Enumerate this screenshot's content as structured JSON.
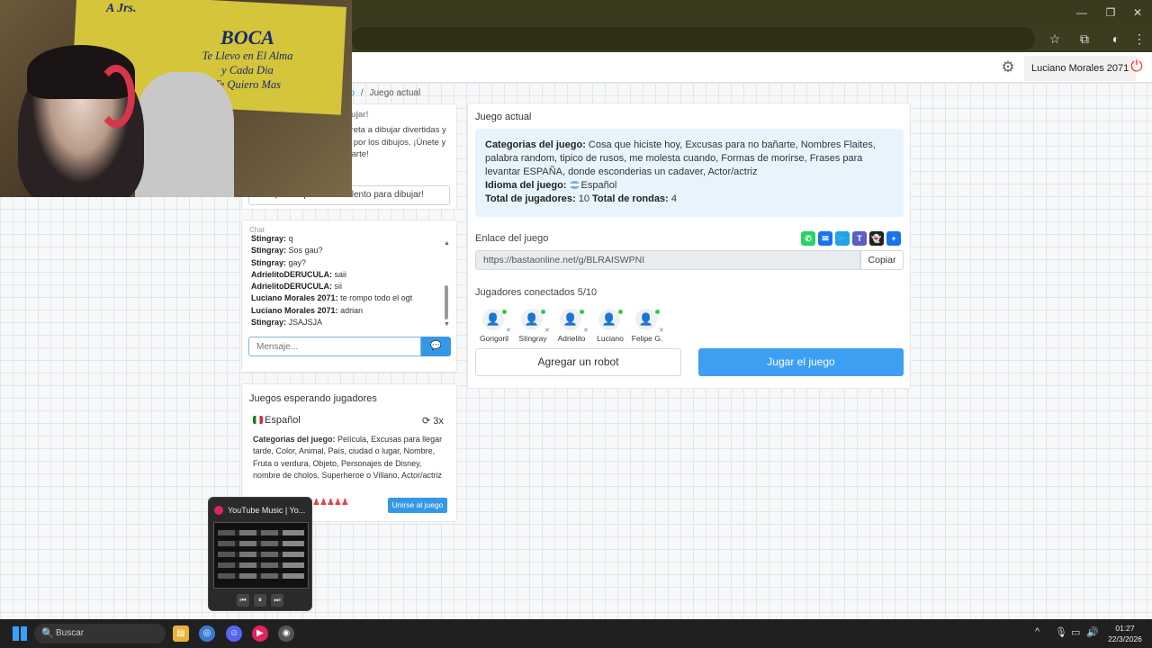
{
  "header": {
    "user_name": "Luciano Morales 2071"
  },
  "breadcrumb": {
    "prev": "evo",
    "separator": "/",
    "current": "Juego actual"
  },
  "promo": {
    "title": "a dibujar!",
    "text": "st te reta a dibujar divertidas y votar por los dibujos. ¡Únete y ra tu arte!",
    "button": "¡Pon a prueba tu talento para dibujar!"
  },
  "chat": {
    "title": "Chat",
    "messages": [
      {
        "user": "Stingray:",
        "text": "q"
      },
      {
        "user": "Stingray:",
        "text": "Sos gau?"
      },
      {
        "user": "Stingray:",
        "text": "gay?"
      },
      {
        "user": "AdrielitoDERUCULA:",
        "text": "saii"
      },
      {
        "user": "AdrielitoDERUCULA:",
        "text": "sii"
      },
      {
        "user": "Luciano Morales 2071:",
        "text": "te rompo todo el ogt"
      },
      {
        "user": "Luciano Morales 2071:",
        "text": "adrian"
      },
      {
        "user": "Stingray:",
        "text": "JSAJSJA"
      }
    ],
    "input_placeholder": "Mensaje..."
  },
  "waiting": {
    "title": "Juegos esperando jugadores",
    "language": "Español",
    "rounds": "3x",
    "categories_label": "Categorias del juego:",
    "categories": "Película, Excusas para llegar tarde, Color, Animal, País, ciudad o lugar, Nombre, Fruta o verdura, Objeto, Personajes de Disney, nombre de cholos, Superheroe o Villano, Actor/actriz",
    "join_button": "Unirse al juego"
  },
  "game": {
    "title": "Juego actual",
    "categories_label": "Categorias del juego:",
    "categories": "Cosa que hiciste hoy, Excusas para no bañarte, Nombres Flaites, palabra random, tipico de rusos, me molesta cuando, Formas de morirse, Frases para levantar ESPAÑA, donde esconderias un cadaver, Actor/actriz",
    "language_label": "Idioma del juego:",
    "language": "Español",
    "players_label": "Total de jugadores:",
    "players_total": "10",
    "rounds_label": "Total de rondas:",
    "rounds_total": "4",
    "link_label": "Enlace del juego",
    "link_value": "https://bastaonline.net/g/BLRAISWPNI",
    "copy_button": "Copiar",
    "connected_label": "Jugadores conectados 5/10",
    "players": [
      {
        "name": "Gorigoril"
      },
      {
        "name": "Stingray"
      },
      {
        "name": "Adrielito"
      },
      {
        "name": "Luciano"
      },
      {
        "name": "Felipe G."
      }
    ],
    "robot_button": "Agregar un robot",
    "play_button": "Jugar el juego"
  },
  "webcam": {
    "banner_left": "A Jrs.",
    "banner_title": "BOCA",
    "banner_lines": [
      "Te Llevo en El Alma",
      "y Cada Dia",
      "Te Quiero Mas"
    ]
  },
  "youtube": {
    "title": "YouTube Music | Yo..."
  },
  "taskbar": {
    "search": "Buscar",
    "time": "01:27",
    "date": "22/3/2026"
  }
}
